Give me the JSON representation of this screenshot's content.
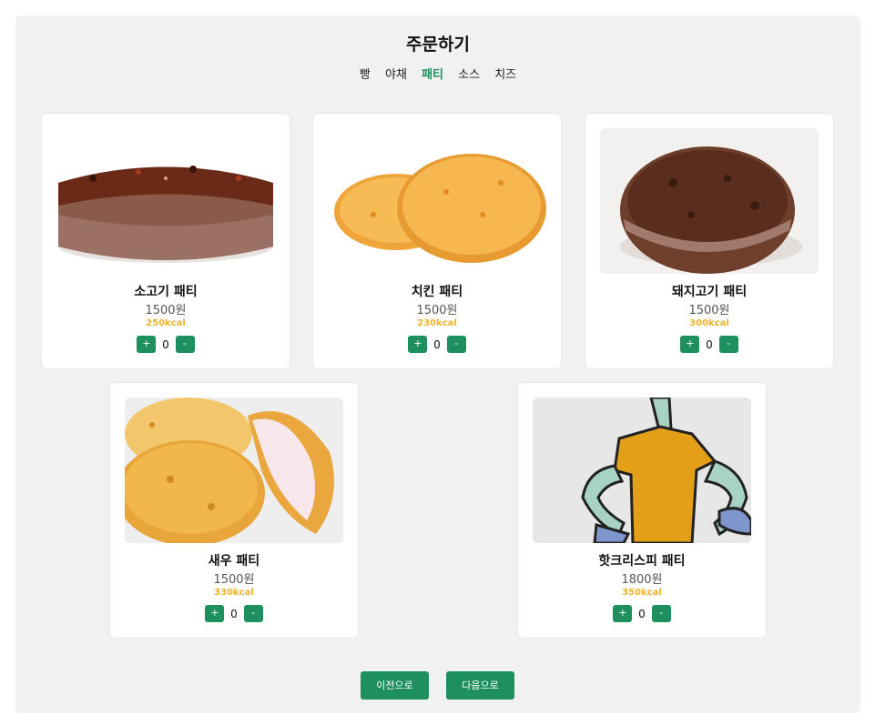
{
  "page": {
    "title": "주문하기"
  },
  "tabs": [
    {
      "label": "빵",
      "active": false
    },
    {
      "label": "야채",
      "active": false
    },
    {
      "label": "패티",
      "active": true
    },
    {
      "label": "소스",
      "active": false
    },
    {
      "label": "치즈",
      "active": false
    }
  ],
  "products": [
    {
      "name": "소고기 패티",
      "price": "1500원",
      "kcal": "250kcal",
      "quantity": "0",
      "image": "beef-patty-image"
    },
    {
      "name": "치킨 패티",
      "price": "1500원",
      "kcal": "230kcal",
      "quantity": "0",
      "image": "chicken-patty-image"
    },
    {
      "name": "돼지고기 패티",
      "price": "1500원",
      "kcal": "300kcal",
      "quantity": "0",
      "image": "pork-patty-image"
    },
    {
      "name": "새우 패티",
      "price": "1500원",
      "kcal": "330kcal",
      "quantity": "0",
      "image": "shrimp-patty-image"
    },
    {
      "name": "핫크리스피 패티",
      "price": "1800원",
      "kcal": "350kcal",
      "quantity": "0",
      "image": "cartoon-character-image"
    }
  ],
  "buttons": {
    "plus": "+",
    "minus": "-",
    "prev": "이전으로",
    "next": "다음으로"
  },
  "colors": {
    "accent": "#1e8f5e",
    "kcal": "#f0b429",
    "panel": "#f1f1f1"
  }
}
